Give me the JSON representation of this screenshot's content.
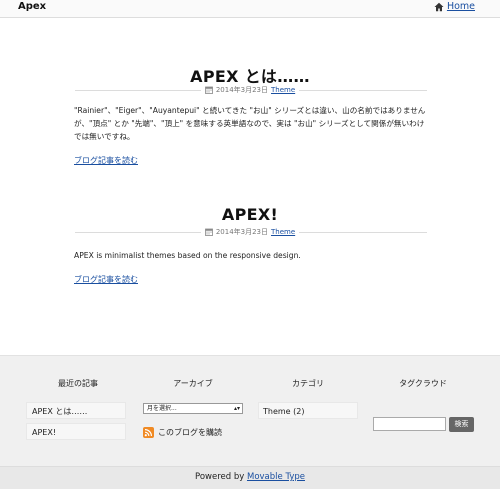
{
  "header": {
    "brand": "Apex",
    "home_label": "Home"
  },
  "posts": [
    {
      "title": "APEX とは……",
      "date": "2014年3月23日",
      "category": "Theme",
      "body": "\"Rainier\"、\"Eiger\"、\"Auyantepui\" と続いてきた \"お山\" シリーズとは違い、山の名前ではありませんが、\"頂点\" とか \"先端\"、\"頂上\" を意味する英単語なので、実は \"お山\" シリーズとして関係が無いわけでは無いですね。",
      "read_more": "ブログ記事を読む"
    },
    {
      "title": "APEX!",
      "date": "2014年3月23日",
      "category": "Theme",
      "body": "APEX is minimalist themes based on the responsive design.",
      "read_more": "ブログ記事を読む"
    }
  ],
  "widgets": {
    "recent": {
      "title": "最近の記事",
      "items": [
        "APEX とは……",
        "APEX!"
      ]
    },
    "archive": {
      "title": "アーカイブ",
      "select_value": "月を選択...",
      "subscribe_label": "このブログを購読"
    },
    "categories": {
      "title": "カテゴリ",
      "items": [
        "Theme (2)"
      ]
    },
    "tagcloud": {
      "title": "タグクラウド",
      "search_button": "検索"
    }
  },
  "footer": {
    "powered_by": "Powered by",
    "platform": "Movable Type"
  },
  "colors": {
    "link": "#1a4fa0",
    "rss_orange": "#f08a24",
    "search_button": "#666666"
  }
}
